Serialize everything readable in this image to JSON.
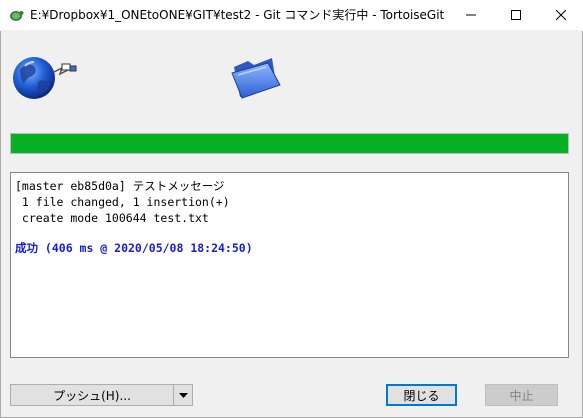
{
  "window": {
    "title": "E:¥Dropbox¥1_ONEtoONE¥GIT¥test2 - Git コマンド実行中 - TortoiseGit"
  },
  "progress": {
    "value_percent": 100,
    "color": "#06b025"
  },
  "log": {
    "lines": [
      "[master eb85d0a] テストメッセージ",
      " 1 file changed, 1 insertion(+)",
      " create mode 100644 test.txt"
    ],
    "result": "成功 (406 ms @ 2020/05/08 18:24:50)",
    "result_color": "#1a1adb"
  },
  "buttons": {
    "push": "プッシュ(H)...",
    "close": "閉じる",
    "abort": "中止"
  },
  "icons": {
    "app": "tortoisegit-icon",
    "globe": "globe-animation-icon",
    "folder": "folder-icon",
    "minimize": "minimize-icon",
    "maximize": "maximize-icon",
    "close": "close-icon",
    "dropdown": "chevron-down-icon"
  }
}
